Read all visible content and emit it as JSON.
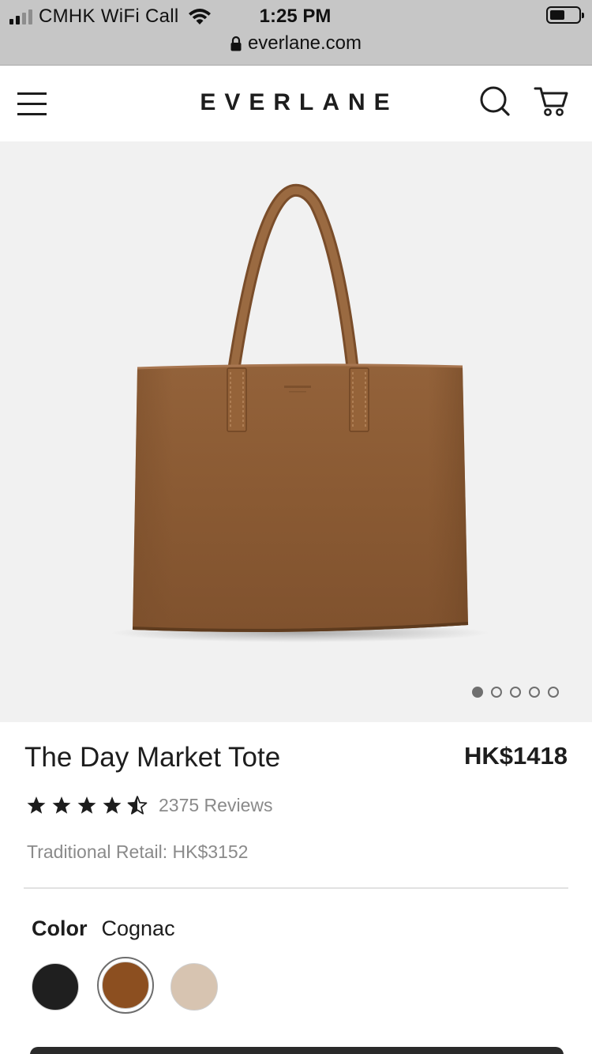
{
  "status_bar": {
    "carrier": "CMHK WiFi Call",
    "time": "1:25 PM",
    "url": "everlane.com"
  },
  "header": {
    "logo": "EVERLANE"
  },
  "gallery": {
    "image_count": 5,
    "active_index": 0
  },
  "product": {
    "title": "The Day Market Tote",
    "price": "HK$1418",
    "rating": 4.5,
    "reviews": "2375 Reviews",
    "traditional_retail": "Traditional Retail: HK$3152"
  },
  "color": {
    "label": "Color",
    "selected": "Cognac",
    "swatches": [
      {
        "name": "Black",
        "hex": "#1f1f1f"
      },
      {
        "name": "Cognac",
        "hex": "#8c4f20"
      },
      {
        "name": "Bone",
        "hex": "#d7c4b1"
      }
    ]
  },
  "colors": {
    "status_bar_bg": "#c6c6c6",
    "leather": "#8a5a34",
    "gallery_bg": "#f1f1f1"
  }
}
